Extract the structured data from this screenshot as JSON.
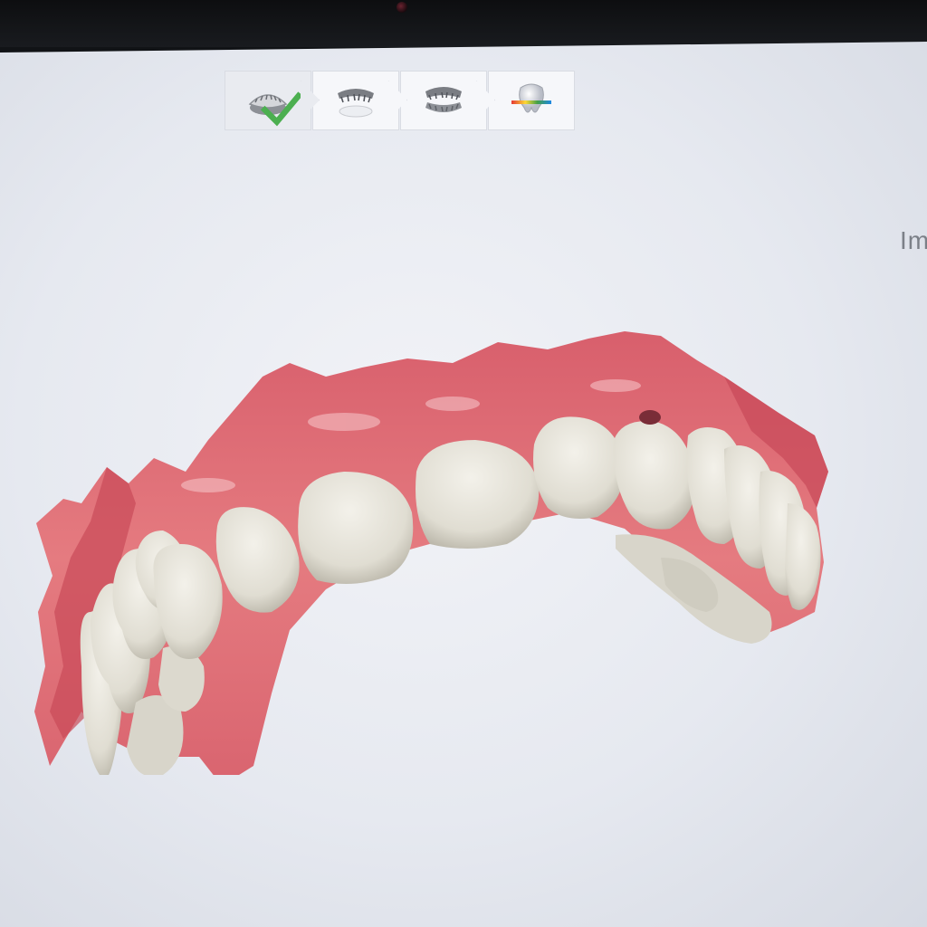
{
  "workflow": {
    "steps": [
      {
        "name": "upper-jaw",
        "icon": "upper-jaw-scan-icon",
        "completed": true
      },
      {
        "name": "lower-jaw",
        "icon": "lower-jaw-scan-icon",
        "completed": false
      },
      {
        "name": "bite",
        "icon": "bite-scan-icon",
        "completed": false
      },
      {
        "name": "analysis",
        "icon": "occlusion-analysis-icon",
        "completed": false
      }
    ]
  },
  "side_label": "Im",
  "colors": {
    "gum": "#e0737a",
    "gum_dark": "#c84858",
    "tooth": "#e8e6dd",
    "tooth_shadow": "#b9b6aa",
    "check": "#4caf50",
    "background": "#eceef3"
  }
}
